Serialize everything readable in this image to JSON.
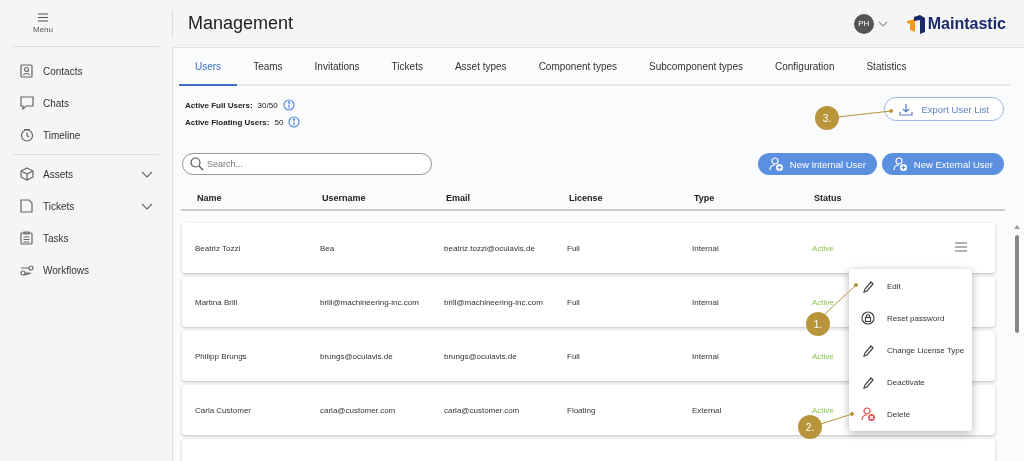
{
  "sidebar": {
    "menu_label": "Menu",
    "items": [
      {
        "label": "Contacts",
        "collapsible": false
      },
      {
        "label": "Chats",
        "collapsible": false
      },
      {
        "label": "Timeline",
        "collapsible": false
      },
      {
        "label": "Assets",
        "collapsible": true
      },
      {
        "label": "Tickets",
        "collapsible": true
      },
      {
        "label": "Tasks",
        "collapsible": false
      },
      {
        "label": "Workflows",
        "collapsible": false
      }
    ]
  },
  "header": {
    "title": "Management",
    "avatar_initials": "PH",
    "logo_text": "Maintastic"
  },
  "tabs": [
    {
      "label": "Users",
      "selected": true
    },
    {
      "label": "Teams",
      "selected": false
    },
    {
      "label": "Invitations",
      "selected": false
    },
    {
      "label": "Tickets",
      "selected": false
    },
    {
      "label": "Asset types",
      "selected": false
    },
    {
      "label": "Component types",
      "selected": false
    },
    {
      "label": "Subcomponent types",
      "selected": false
    },
    {
      "label": "Configuration",
      "selected": false
    },
    {
      "label": "Statistics",
      "selected": false
    }
  ],
  "stats": [
    {
      "label": "Active Full Users:",
      "value": "30/50"
    },
    {
      "label": "Active Floating Users:",
      "value": "50"
    }
  ],
  "export_button": "Export User List",
  "search": {
    "placeholder": "Search..."
  },
  "new_buttons": [
    "New Internal User",
    "New External User"
  ],
  "table": {
    "columns": [
      "Name",
      "Username",
      "Email",
      "License",
      "Type",
      "Status"
    ],
    "rows": [
      {
        "cells": [
          "Beatriz Tozzi",
          "Bea",
          "beatriz.tozzi@oculavis.de",
          "Full",
          "Internal",
          "Active"
        ],
        "actions_visible": true
      },
      {
        "cells": [
          "Martina Brill",
          "brill@machineering-inc.com",
          "brill@machineering-inc.com",
          "Full",
          "Internal",
          "Active"
        ],
        "actions_visible": false
      },
      {
        "cells": [
          "Philipp Brungs",
          "brungs@oculavis.de",
          "brungs@oculavis.de",
          "Full",
          "Internal",
          "Active"
        ],
        "actions_visible": false
      },
      {
        "cells": [
          "Carla Customer",
          "carla@customer.com",
          "carla@customer.com",
          "Floating",
          "External",
          "Active"
        ],
        "actions_visible": false
      }
    ]
  },
  "context_menu": [
    {
      "label": "Edit"
    },
    {
      "label": "Reset password"
    },
    {
      "label": "Change License Type"
    },
    {
      "label": "Deactivate"
    },
    {
      "label": "Delete"
    }
  ],
  "annotations": [
    {
      "label": "3."
    },
    {
      "label": "1."
    },
    {
      "label": "2."
    }
  ]
}
